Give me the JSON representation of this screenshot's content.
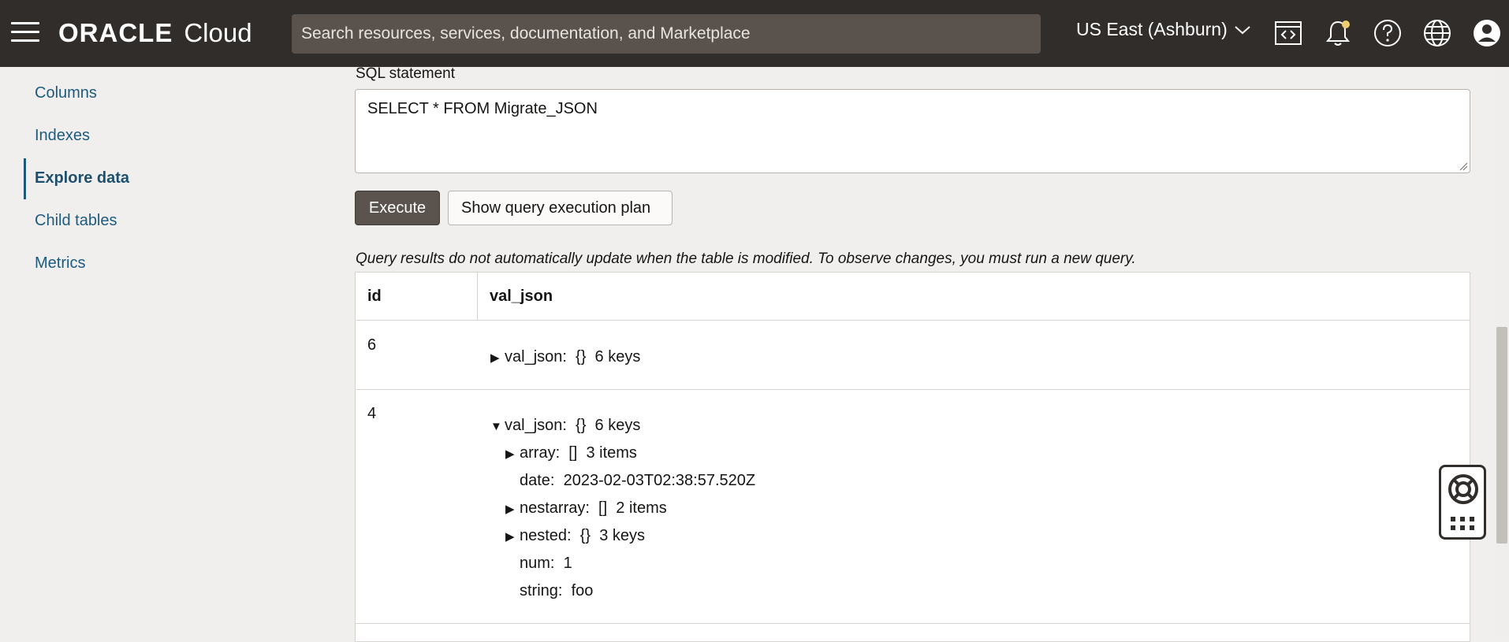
{
  "header": {
    "brand_oracle": "ORACLE",
    "brand_cloud": "Cloud",
    "search_placeholder": "Search resources, services, documentation, and Marketplace",
    "region": "US East (Ashburn)"
  },
  "sidebar": {
    "items": [
      {
        "label": "Columns"
      },
      {
        "label": "Indexes"
      },
      {
        "label": "Explore data"
      },
      {
        "label": "Child tables"
      },
      {
        "label": "Metrics"
      }
    ]
  },
  "main": {
    "sql_label": "SQL statement",
    "sql_value": "SELECT * FROM Migrate_JSON",
    "execute_label": "Execute",
    "plan_label": "Show query execution plan",
    "notice": "Query results do not automatically update when the table is modified. To observe changes, you must run a new query.",
    "table": {
      "headers": [
        "id",
        "val_json"
      ],
      "rows": [
        {
          "id": "6",
          "summary": "val_json:  {}  6 keys"
        },
        {
          "id": "4",
          "summary": "val_json:  {}  6 keys",
          "children": [
            "array:  []  3 items",
            "date:  2023-02-03T02:38:57.520Z",
            "nestarray:  []  2 items",
            "nested:  {}  3 keys",
            "num:  1",
            "string:  foo"
          ]
        }
      ]
    }
  },
  "colors": {
    "topbar": "#312d2a",
    "link": "#1d5b7e",
    "execute_bg": "#5b544e",
    "notification_dot": "#f0cc71"
  },
  "icons": [
    "hamburger-icon",
    "chevron-down-icon",
    "code-editor-icon",
    "bell-icon",
    "help-icon",
    "globe-icon",
    "profile-icon",
    "kebab-menu-icon",
    "lifebuoy-icon",
    "grid-icon"
  ]
}
